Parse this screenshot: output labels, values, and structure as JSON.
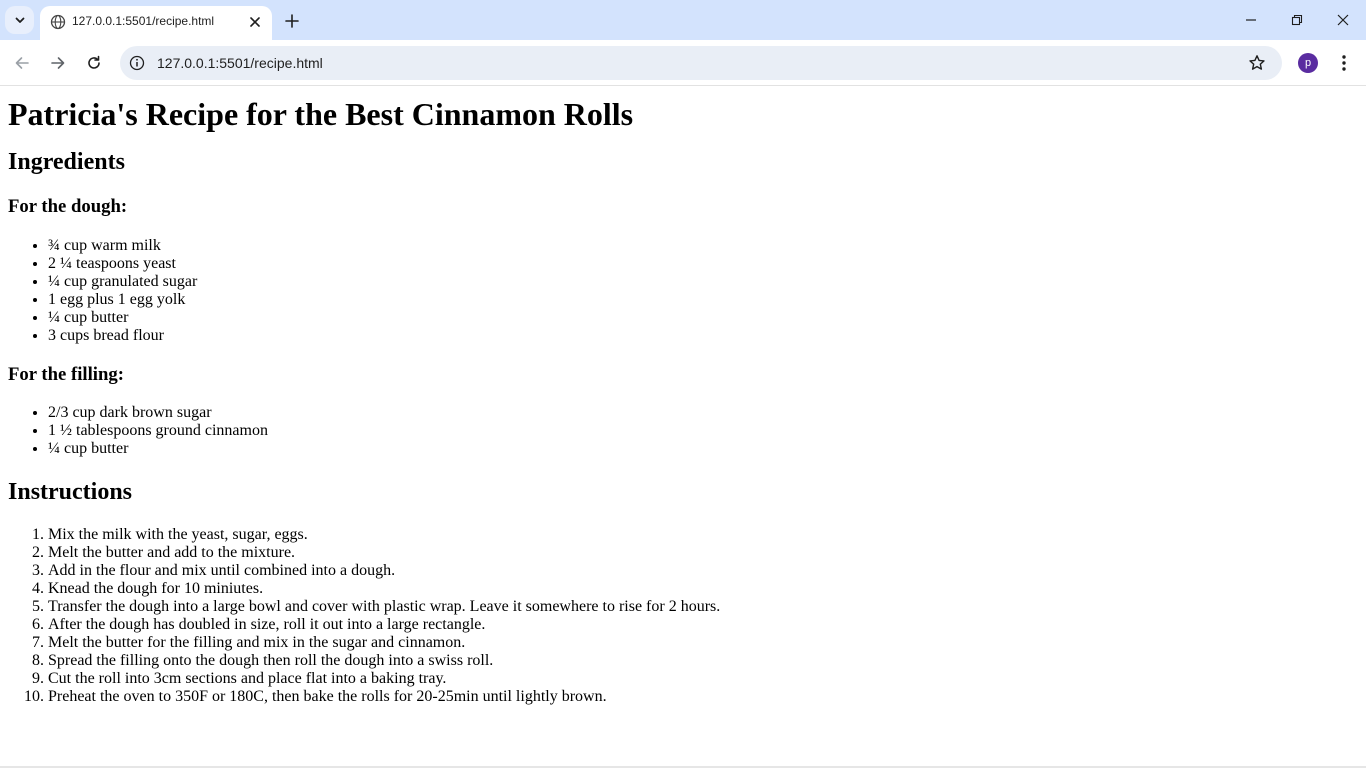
{
  "browser": {
    "tab_title": "127.0.0.1:5501/recipe.html",
    "url": "127.0.0.1:5501/recipe.html",
    "profile_initial": "p",
    "accent_color": "#5a2ca0",
    "tabstrip_color": "#d3e3fd"
  },
  "page": {
    "title": "Patricia's Recipe for the Best Cinnamon Rolls",
    "ingredients_heading": "Ingredients",
    "dough_heading": "For the dough:",
    "dough_items": [
      "¾ cup warm milk",
      "2 ¼ teaspoons yeast",
      "¼ cup granulated sugar",
      "1 egg plus 1 egg yolk",
      "¼ cup butter",
      "3 cups bread flour"
    ],
    "filling_heading": "For the filling:",
    "filling_items": [
      "2/3 cup dark brown sugar",
      "1 ½ tablespoons ground cinnamon",
      "¼ cup butter"
    ],
    "instructions_heading": "Instructions",
    "instructions": [
      "Mix the milk with the yeast, sugar, eggs.",
      "Melt the butter and add to the mixture.",
      "Add in the flour and mix until combined into a dough.",
      "Knead the dough for 10 miniutes.",
      "Transfer the dough into a large bowl and cover with plastic wrap. Leave it somewhere to rise for 2 hours.",
      "After the dough has doubled in size, roll it out into a large rectangle.",
      "Melt the butter for the filling and mix in the sugar and cinnamon.",
      "Spread the filling onto the dough then roll the dough into a swiss roll.",
      "Cut the roll into 3cm sections and place flat into a baking tray.",
      "Preheat the oven to 350F or 180C, then bake the rolls for 20-25min until lightly brown."
    ]
  }
}
